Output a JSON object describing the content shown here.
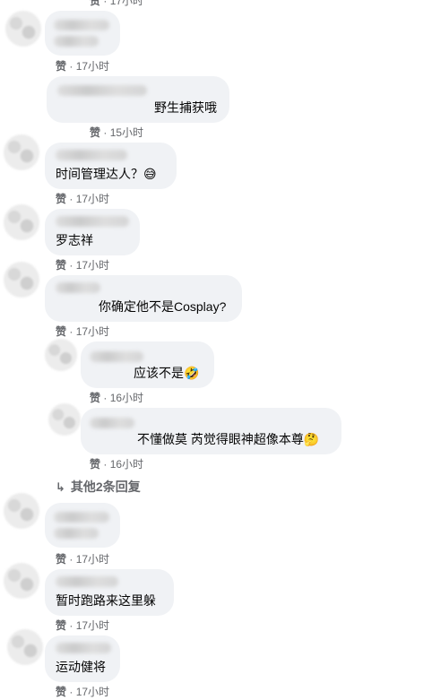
{
  "comments": [
    {
      "text": "",
      "emoji": "",
      "time": "17小时"
    },
    {
      "text": "野生捕获哦",
      "emoji": "",
      "time": "15小时"
    },
    {
      "text": "时间管理达人？",
      "emoji": "😅",
      "time": "17小时"
    },
    {
      "text": "罗志祥",
      "emoji": "",
      "time": "17小时"
    },
    {
      "text": "你确定他不是Cosplay?",
      "emoji": "",
      "time": "17小时"
    },
    {
      "text": "应该不是",
      "emoji": "🤣",
      "time": "16小时"
    },
    {
      "text": "不懂做莫 芮觉得眼神超像本尊",
      "emoji": "🤔",
      "time": "16小时"
    },
    {
      "text": "",
      "emoji": "",
      "time": "17小时"
    },
    {
      "text": "暂时跑路来这里躲",
      "emoji": "",
      "time": "17小时"
    },
    {
      "text": "运动健将",
      "emoji": "",
      "time": "17小时"
    }
  ],
  "like_label": "赞",
  "separator": " · ",
  "more_replies": {
    "label": "其他2条回复",
    "icon": "reply-arrow-icon"
  },
  "colors": {
    "bubble": "#f0f2f5",
    "meta": "#65676b",
    "text": "#050505"
  }
}
